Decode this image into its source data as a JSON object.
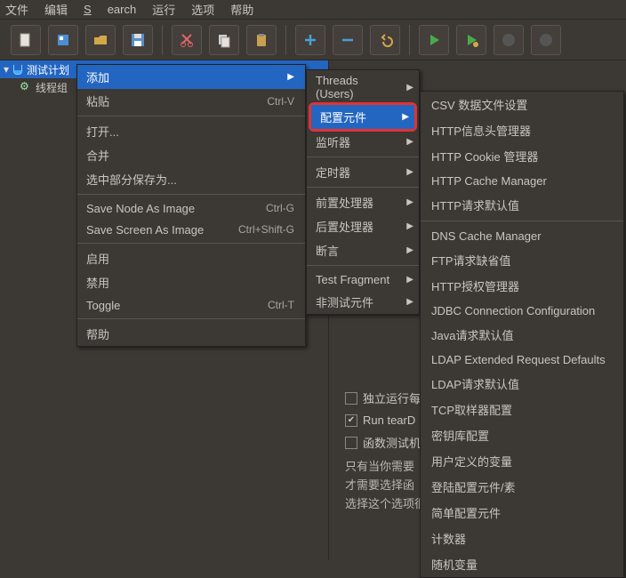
{
  "menubar": {
    "file": "文件",
    "edit": "编辑",
    "search": "Search",
    "run": "运行",
    "options": "选项",
    "help": "帮助"
  },
  "tree": {
    "plan": "测试计划",
    "tg": "线程组"
  },
  "ctx1": {
    "add": "添加",
    "paste": "粘贴",
    "paste_sc": "Ctrl-V",
    "open": "打开...",
    "merge": "合并",
    "saveSel": "选中部分保存为...",
    "saveNode": "Save Node As Image",
    "saveNode_sc": "Ctrl-G",
    "saveScreen": "Save Screen As Image",
    "saveScreen_sc": "Ctrl+Shift-G",
    "enable": "启用",
    "disable": "禁用",
    "toggle": "Toggle",
    "toggle_sc": "Ctrl-T",
    "helpItem": "帮助"
  },
  "ctx2": {
    "threads": "Threads (Users)",
    "config": "配置元件",
    "listener": "监听器",
    "timer": "定时器",
    "pre": "前置处理器",
    "post": "后置处理器",
    "assert": "断言",
    "frag": "Test Fragment",
    "nontest": "非测试元件"
  },
  "ctx3": {
    "csv": "CSV 数据文件设置",
    "httpHeader": "HTTP信息头管理器",
    "cookie": "HTTP Cookie 管理器",
    "cache": "HTTP Cache Manager",
    "reqDefaults": "HTTP请求默认值",
    "dns": "DNS Cache Manager",
    "ftp": "FTP请求缺省值",
    "auth": "HTTP授权管理器",
    "jdbc": "JDBC Connection Configuration",
    "java": "Java请求默认值",
    "ldapExt": "LDAP Extended Request Defaults",
    "ldap": "LDAP请求默认值",
    "tcp": "TCP取样器配置",
    "keystore": "密钥库配置",
    "userVars": "用户定义的变量",
    "login": "登陆配置元件/素",
    "simple": "简单配置元件",
    "counter": "计数器",
    "random": "随机变量"
  },
  "opts": {
    "standalone": "独立运行每",
    "teardown": "Run tearD",
    "functest": "函数测试机",
    "desc1": "只有当你需要",
    "desc2": "才需要选择函",
    "note": "选择这个选项很影响性能。"
  }
}
